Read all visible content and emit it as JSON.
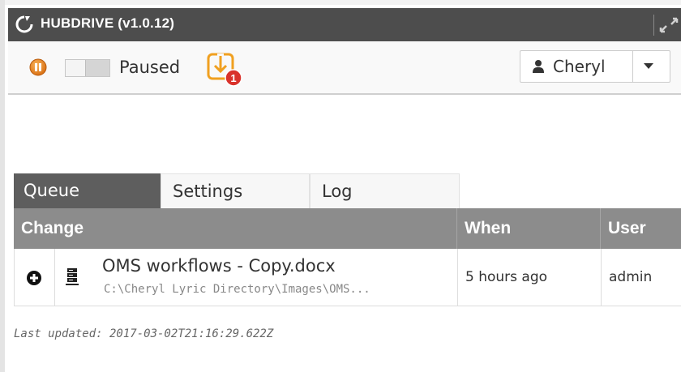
{
  "window": {
    "title": "HUBDRIVE (v1.0.12)",
    "icons": {
      "logo": "hubdrive-logo-icon",
      "expand": "expand-window-icon"
    }
  },
  "toolbar": {
    "pause_icon": "pause-circle-icon",
    "status_label": "Paused",
    "sync_toggle_on": false,
    "download_icon": "download-arrow-icon",
    "download_badge": "1",
    "user": {
      "name": "Cheryl",
      "icon": "user-icon",
      "menu_icon": "caret-down-icon"
    }
  },
  "tabs": [
    {
      "label": "Queue",
      "active": true
    },
    {
      "label": "Settings",
      "active": false
    },
    {
      "label": "Log",
      "active": false
    }
  ],
  "table": {
    "headers": {
      "change": "Change",
      "when": "When",
      "user": "User"
    },
    "rows": [
      {
        "action_icon": "plus-circle-icon",
        "type_icon": "server-icon",
        "file_name": "OMS workflows - Copy.docx",
        "file_path": "C:\\Cheryl Lyric Directory\\Images\\OMS...",
        "when": "5 hours ago",
        "user": "admin"
      }
    ]
  },
  "footer": {
    "last_updated": "Last updated: 2017-03-02T21:16:29.622Z"
  },
  "colors": {
    "titlebar": "#4d4d4d",
    "active_tab": "#5e5e5e",
    "table_header": "#8c8c8c",
    "pause_orange": "#e07b18",
    "badge_red": "#d9322b"
  }
}
